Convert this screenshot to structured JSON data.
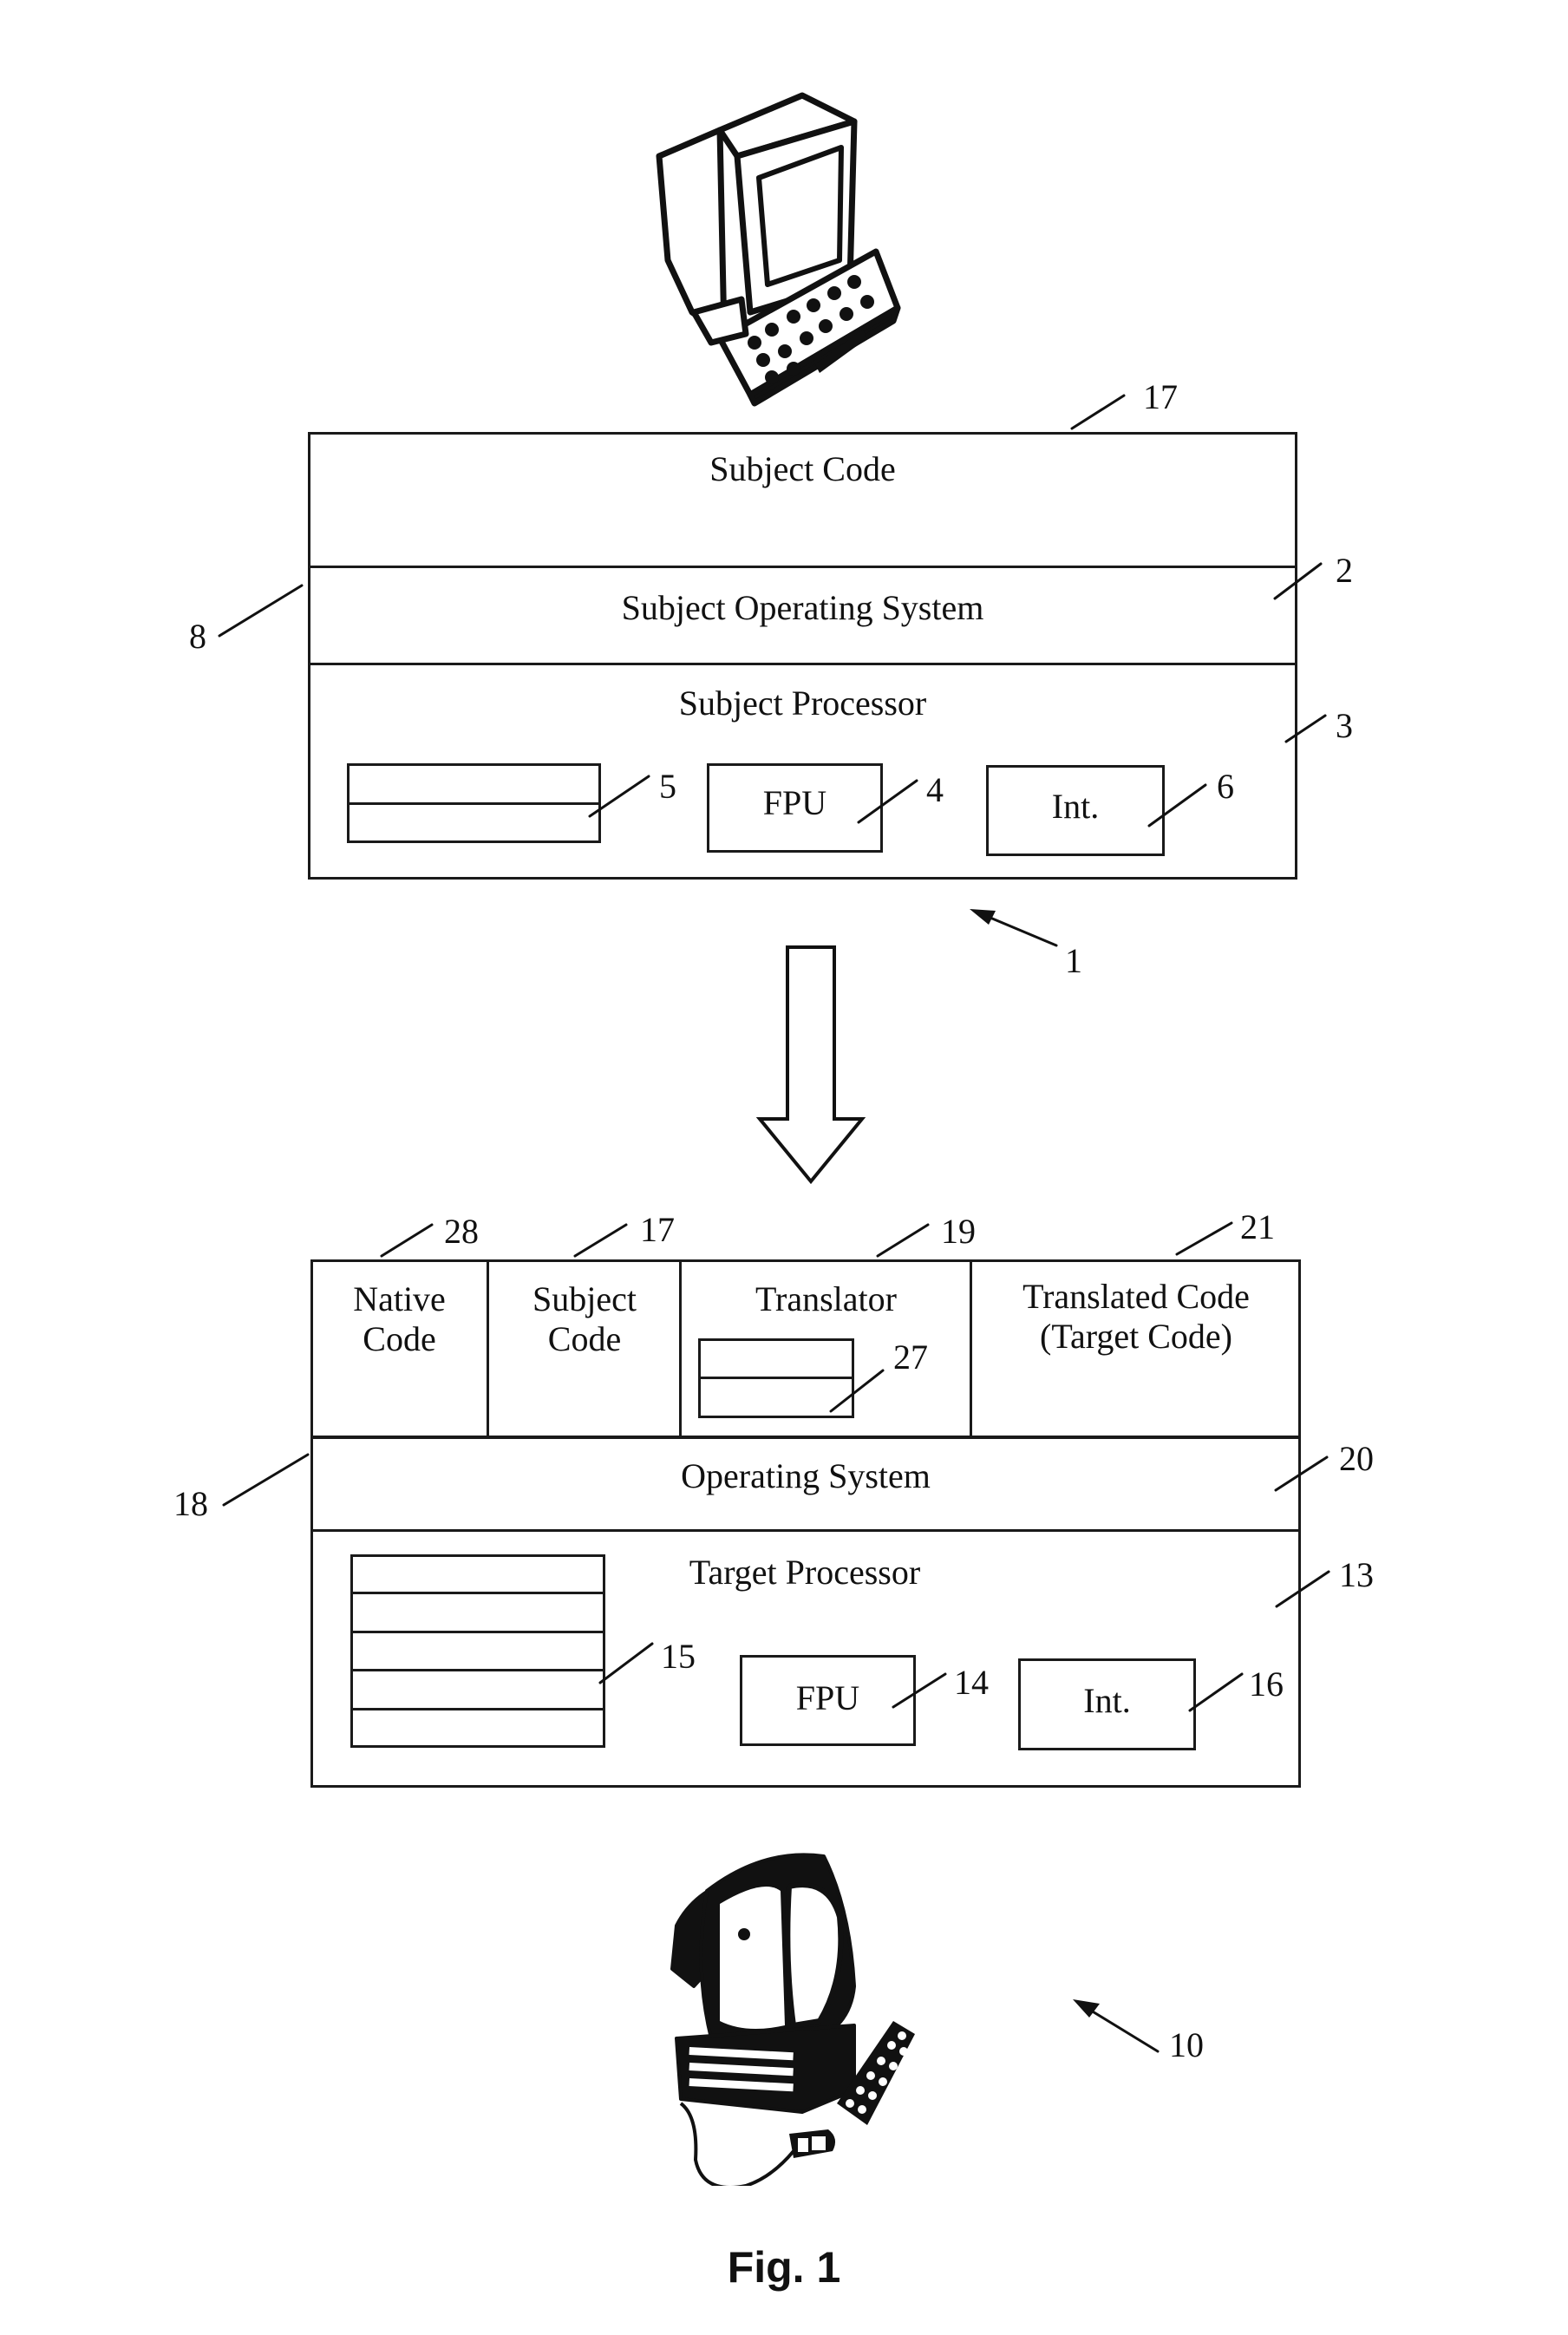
{
  "figure": {
    "caption": "Fig. 1"
  },
  "subject_system": {
    "ref": "1",
    "outer_ref": "8",
    "layers": {
      "code": {
        "label": "Subject Code",
        "ref": "17"
      },
      "os": {
        "label": "Subject Operating System",
        "ref": "2"
      },
      "processor": {
        "label": "Subject Processor",
        "ref": "3",
        "registers": {
          "ref": "5",
          "rows": 2
        },
        "fpu": {
          "label": "FPU",
          "ref": "4"
        },
        "int": {
          "label": "Int.",
          "ref": "6"
        }
      }
    }
  },
  "target_system": {
    "ref": "10",
    "outer_ref": "18",
    "top_row": [
      {
        "label_line1": "Native",
        "label_line2": "Code",
        "ref": "28"
      },
      {
        "label_line1": "Subject",
        "label_line2": "Code",
        "ref": "17"
      },
      {
        "label_line1": "Translator",
        "label_line2": "",
        "ref": "19",
        "inner_ref": "27"
      },
      {
        "label_line1": "Translated Code",
        "label_line2": "(Target Code)",
        "ref": "21"
      }
    ],
    "os": {
      "label": "Operating System",
      "ref": "20"
    },
    "processor": {
      "label": "Target Processor",
      "ref": "13",
      "registers": {
        "ref": "15",
        "rows": 5
      },
      "fpu": {
        "label": "FPU",
        "ref": "14"
      },
      "int": {
        "label": "Int.",
        "ref": "16"
      }
    }
  }
}
